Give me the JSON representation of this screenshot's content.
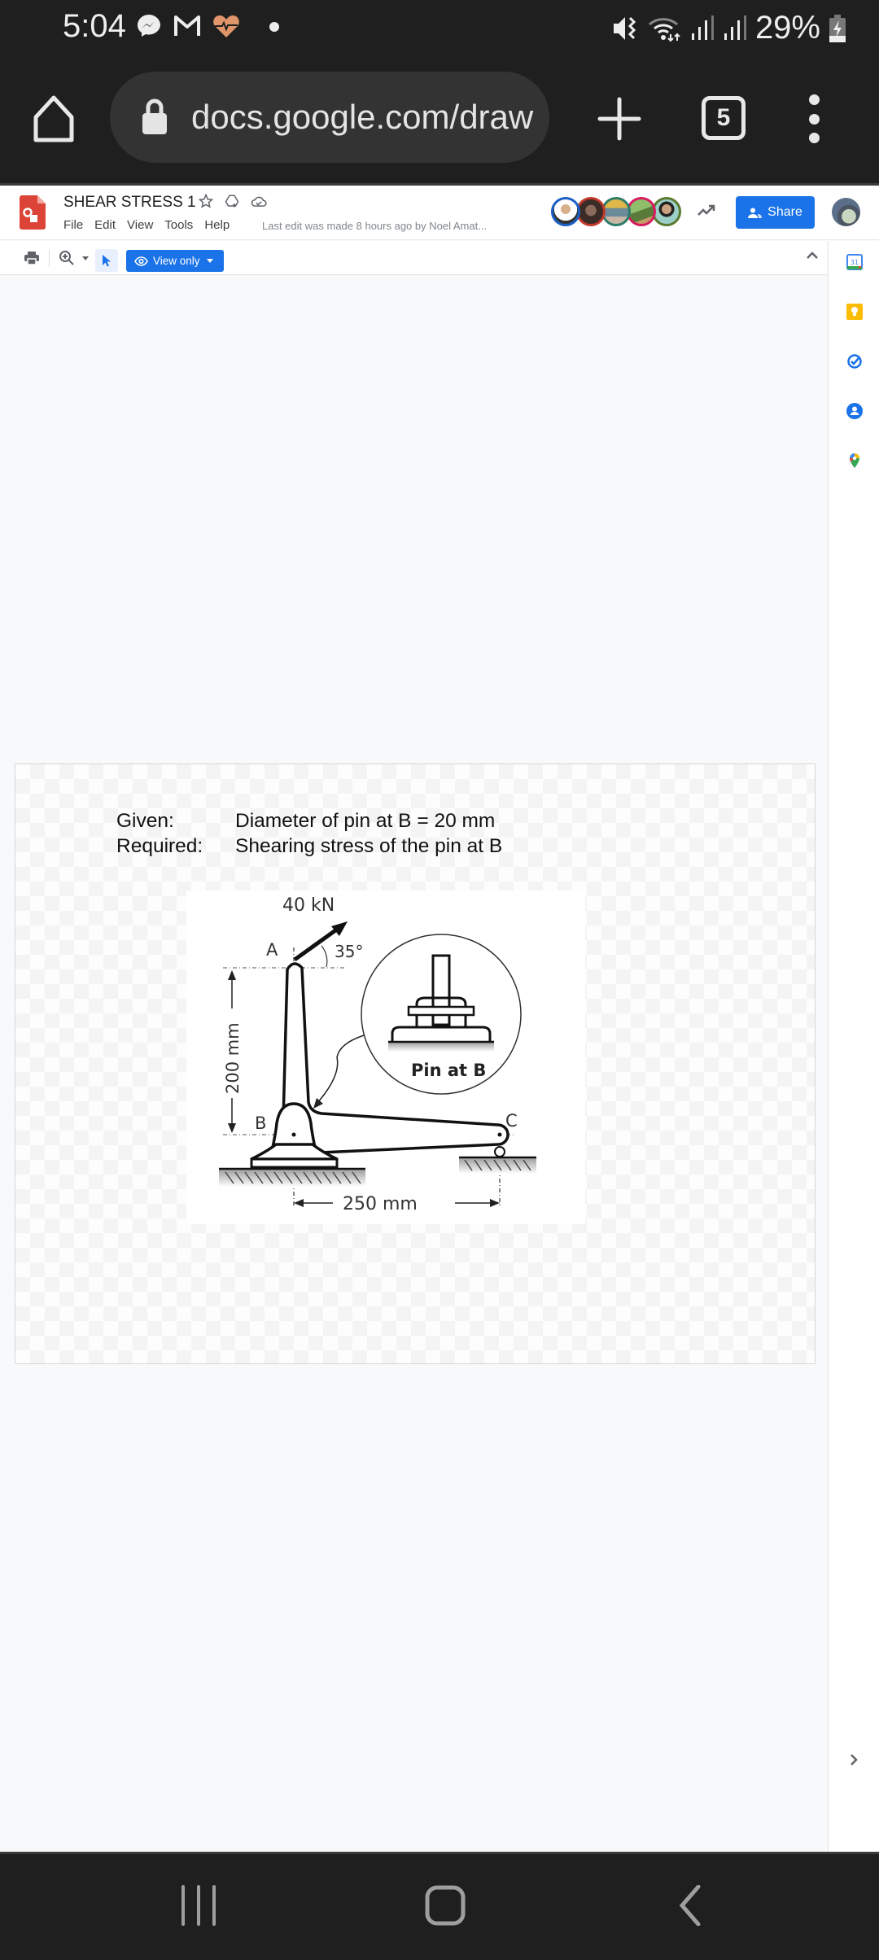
{
  "status_bar": {
    "time": "5:04",
    "notification_icons": [
      "messenger-icon",
      "gmail-icon",
      "health-heart-icon",
      "dot-icon"
    ],
    "system_icons": [
      "vibrate-mute-icon",
      "wifi-icon",
      "signal-icon",
      "signal-icon"
    ],
    "battery_percent": "29%",
    "battery_state": "charging"
  },
  "browser": {
    "url": "docs.google.com/draw",
    "tab_count": "5",
    "colors": {
      "bar_bg": "#1f1f1f",
      "pill_bg": "#333333"
    }
  },
  "docs_header": {
    "title": "SHEAR STRESS 1",
    "menu": [
      "File",
      "Edit",
      "View",
      "Tools",
      "Help"
    ],
    "last_edit": "Last edit was made 8 hours ago by Noel Amat...",
    "collaborator_ring_colors": [
      "#1a5fc4",
      "#c0392b",
      "#2e7d6a",
      "#d81b60",
      "#5a7a2e"
    ],
    "share_label": "Share",
    "brand_color": "#1a73e8",
    "logo_color": "#db4437"
  },
  "toolbar": {
    "view_only_label": "View only"
  },
  "side_panel": {
    "apps": [
      "calendar-icon",
      "keep-icon",
      "tasks-icon",
      "contacts-icon",
      "maps-icon"
    ],
    "calendar_day": "31"
  },
  "slide": {
    "given_label": "Given:",
    "given_text": "Diameter of pin at B = 20 mm",
    "required_label": "Required:",
    "required_text": "Shearing stress of the pin at B",
    "figure": {
      "force_label": "40 kN",
      "angle_label": "35°",
      "point_a": "A",
      "point_b": "B",
      "point_c": "C",
      "vertical_dim": "200 mm",
      "horizontal_dim": "250 mm",
      "inset_label": "Pin at B"
    }
  }
}
